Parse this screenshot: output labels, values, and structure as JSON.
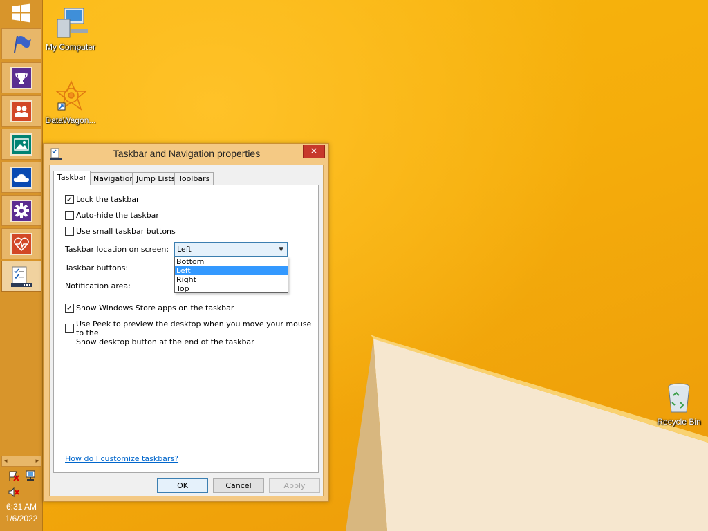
{
  "desktop": {
    "icons": [
      {
        "label": "My Computer",
        "icon": "computer-icon"
      },
      {
        "label": "DataWagon...",
        "icon": "datawagon-shortcut-icon"
      },
      {
        "label": "Recycle Bin",
        "icon": "recycle-bin-icon"
      }
    ]
  },
  "taskbar": {
    "location": "Left",
    "start_icon": "windows-logo-icon",
    "pinned": [
      {
        "icon": "flag-icon",
        "color": "#c08a3c"
      },
      {
        "icon": "trophy-icon",
        "color": "#5b2e91"
      },
      {
        "icon": "people-icon",
        "color": "#d24726"
      },
      {
        "icon": "photos-icon",
        "color": "#008272"
      },
      {
        "icon": "onedrive-icon",
        "color": "#094ab2"
      },
      {
        "icon": "settings-gear-icon",
        "color": "#5c2d91"
      },
      {
        "icon": "health-heart-icon",
        "color": "#d24726"
      },
      {
        "icon": "taskbar-properties-icon",
        "color": "#ffffff"
      }
    ],
    "tray": {
      "time": "6:31 AM",
      "date": "1/6/2022",
      "icons": [
        "action-center-flag-icon",
        "network-icon",
        "volume-muted-icon"
      ]
    }
  },
  "dialog": {
    "title": "Taskbar and Navigation properties",
    "tabs": [
      "Taskbar",
      "Navigation",
      "Jump Lists",
      "Toolbars"
    ],
    "active_tab": "Taskbar",
    "checkboxes": [
      {
        "label": "Lock the taskbar",
        "checked": true
      },
      {
        "label": "Auto-hide the taskbar",
        "checked": false
      },
      {
        "label": "Use small taskbar buttons",
        "checked": false
      },
      {
        "label": "Show Windows Store apps on the taskbar",
        "checked": true
      },
      {
        "label_line1": "Use Peek to preview the desktop when you move your mouse to the",
        "label_line2": "Show desktop button at the end of the taskbar",
        "checked": false
      }
    ],
    "location_label": "Taskbar location on screen:",
    "location_value": "Left",
    "location_options": [
      "Bottom",
      "Left",
      "Right",
      "Top"
    ],
    "buttons_label": "Taskbar buttons:",
    "notification_label": "Notification area:",
    "help_link": "How do I customize taskbars?",
    "ok": "OK",
    "cancel": "Cancel",
    "apply": "Apply",
    "close_icon": "close-icon"
  },
  "colors": {
    "wallpaper": "#f5ad0b",
    "taskbar": "#d8952b",
    "window_frame": "#f4c984",
    "close_button": "#c7392b",
    "selection": "#3399ff",
    "link": "#0066cc"
  }
}
